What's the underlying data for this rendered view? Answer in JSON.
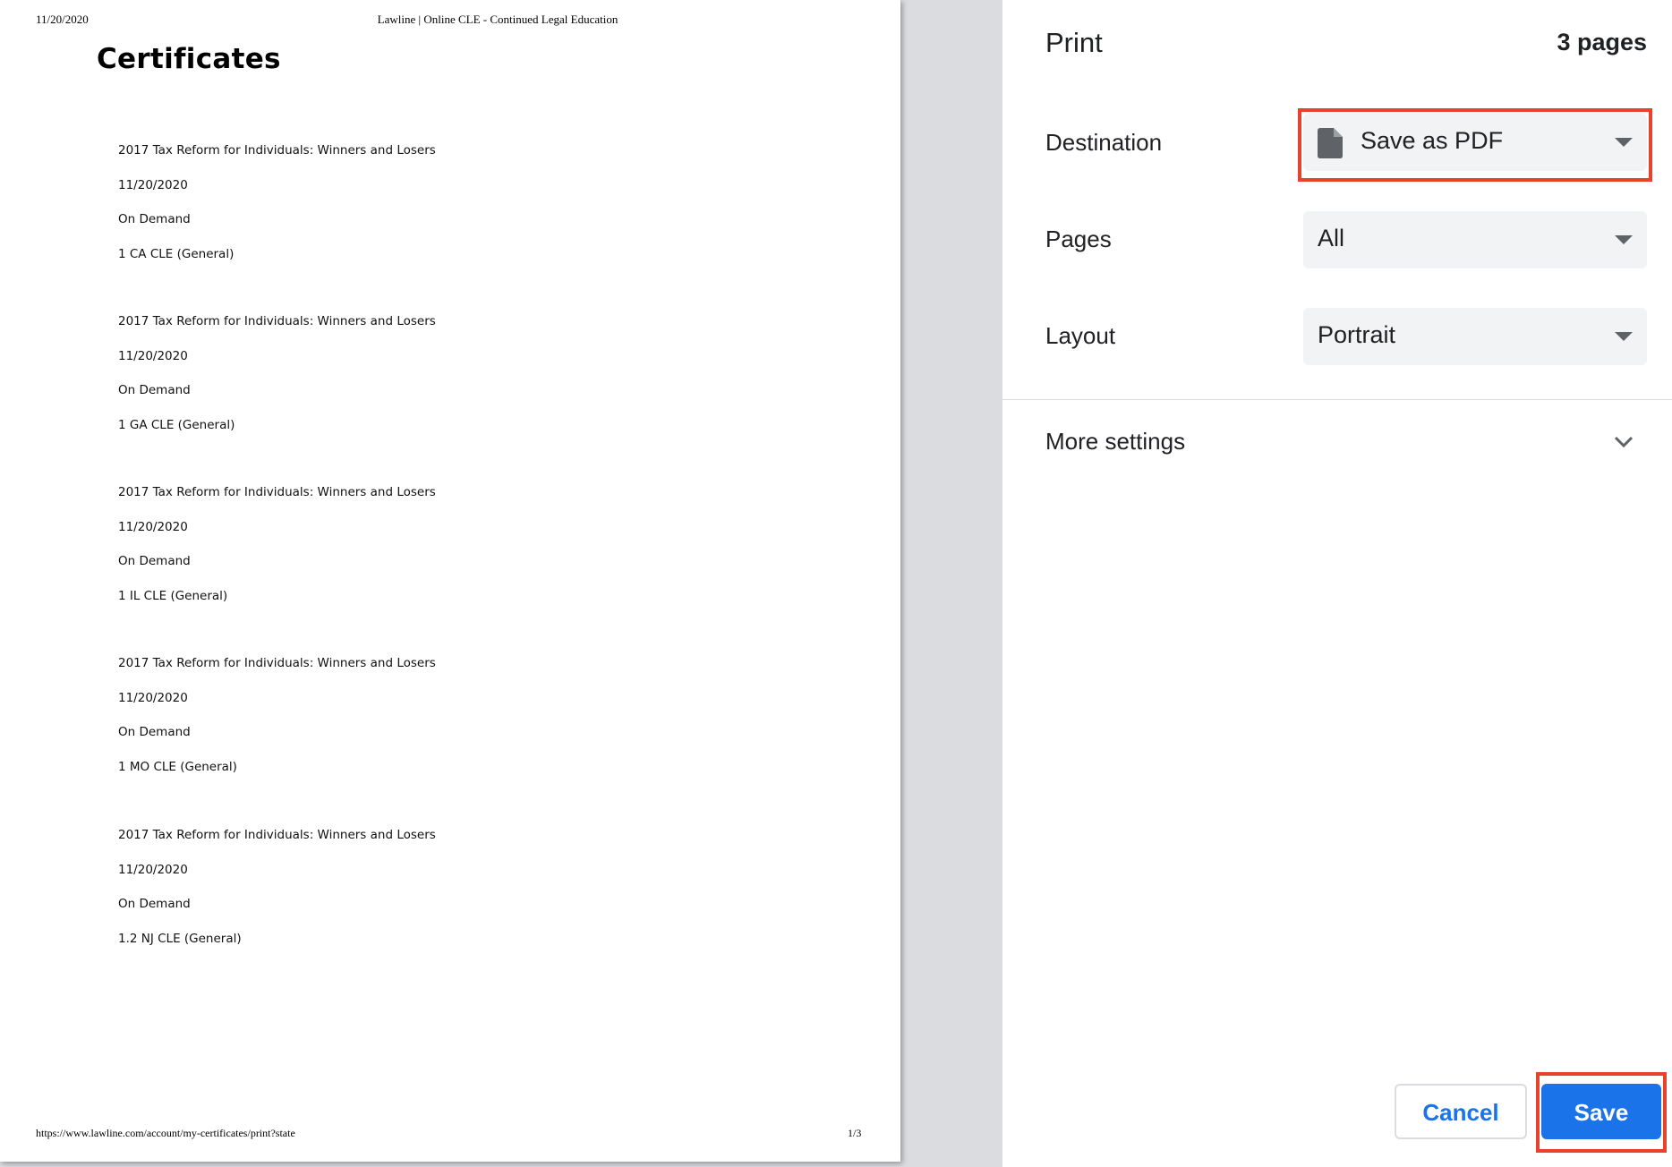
{
  "preview": {
    "header_date": "11/20/2020",
    "header_title": "Lawline | Online CLE - Continued Legal Education",
    "heading": "Certificates",
    "certificates": [
      {
        "title": "2017 Tax Reform for Individuals: Winners and Losers",
        "date": "11/20/2020",
        "format": "On Demand",
        "credit": "1 CA CLE (General)"
      },
      {
        "title": "2017 Tax Reform for Individuals: Winners and Losers",
        "date": "11/20/2020",
        "format": "On Demand",
        "credit": "1 GA CLE (General)"
      },
      {
        "title": "2017 Tax Reform for Individuals: Winners and Losers",
        "date": "11/20/2020",
        "format": "On Demand",
        "credit": "1 IL CLE (General)"
      },
      {
        "title": "2017 Tax Reform for Individuals: Winners and Losers",
        "date": "11/20/2020",
        "format": "On Demand",
        "credit": "1 MO CLE (General)"
      },
      {
        "title": "2017 Tax Reform for Individuals: Winners and Losers",
        "date": "11/20/2020",
        "format": "On Demand",
        "credit": "1.2 NJ CLE (General)"
      }
    ],
    "footer_url": "https://www.lawline.com/account/my-certificates/print?state",
    "footer_page": "1/3"
  },
  "print_panel": {
    "title": "Print",
    "sheet_count": "3 pages",
    "destination": {
      "label": "Destination",
      "value": "Save as PDF",
      "icon": "document-icon"
    },
    "pages": {
      "label": "Pages",
      "value": "All"
    },
    "layout": {
      "label": "Layout",
      "value": "Portrait"
    },
    "more_settings": {
      "label": "More settings",
      "icon": "chevron-down-icon"
    },
    "cancel_label": "Cancel",
    "save_label": "Save"
  },
  "colors": {
    "accent": "#1a73e8",
    "highlight": "#e8412c",
    "select_bg": "#f1f3f4",
    "preview_bg": "#dadce0"
  }
}
